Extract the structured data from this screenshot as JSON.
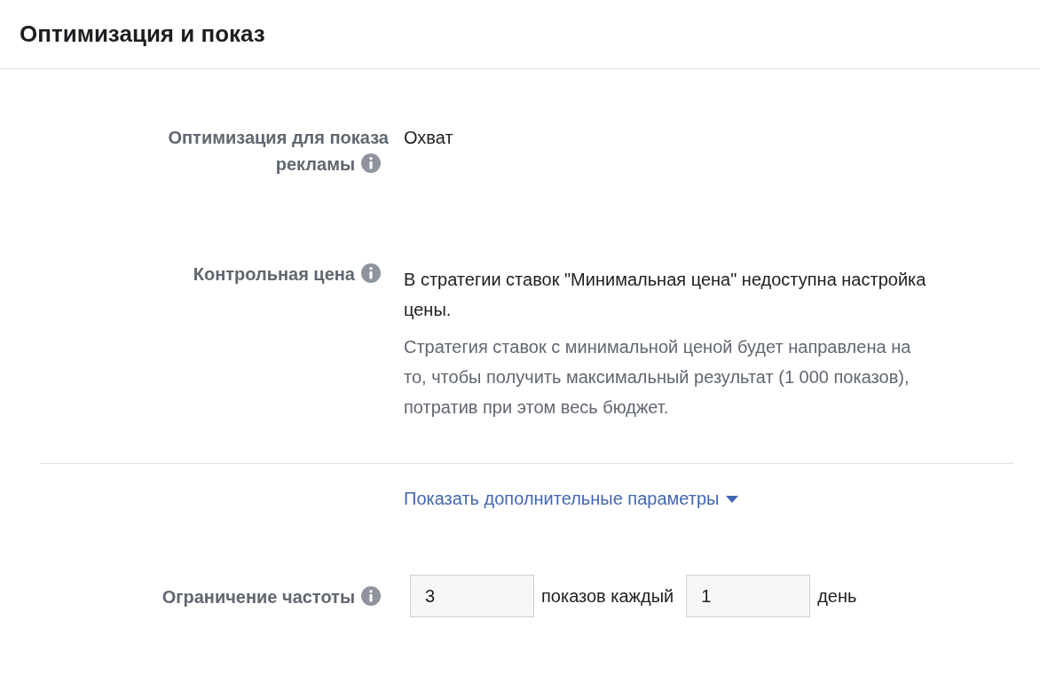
{
  "title": "Оптимизация и показ",
  "fields": [
    {
      "kind": "text",
      "label": "Оптимизация для показа рекламы",
      "value": "Охват"
    },
    {
      "kind": "note",
      "label": "Контрольная цена",
      "value": "В стратегии ставок \"Минимальная цена\" недоступна настройка цены.",
      "note": "Стратегия ставок с минимальной ценой будет направлена на то, чтобы получить максимальный результат (1 000 показов), потратив при этом весь бюджет."
    }
  ],
  "more_link": "Показать дополнительные параметры",
  "frequency": {
    "label": "Ограничение частоты",
    "count": "3",
    "between": "показов каждый",
    "period": "1",
    "unit": "день"
  }
}
